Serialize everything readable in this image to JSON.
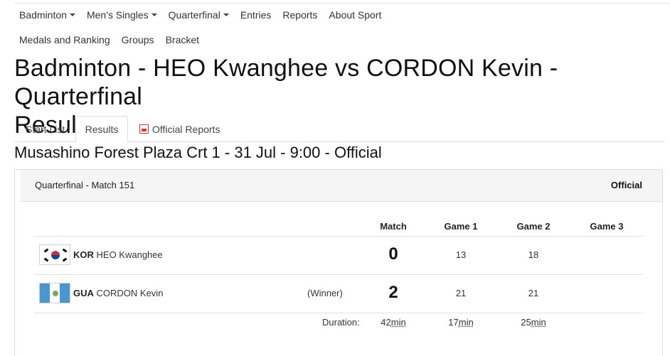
{
  "nav": {
    "row1": [
      {
        "label": "Badminton",
        "dropdown": true
      },
      {
        "label": "Men's Singles",
        "dropdown": true
      },
      {
        "label": "Quarterfinal",
        "dropdown": true
      },
      {
        "label": "Entries",
        "dropdown": false
      },
      {
        "label": "Reports",
        "dropdown": false
      },
      {
        "label": "About Sport",
        "dropdown": false
      }
    ],
    "row2": [
      {
        "label": "Medals and Ranking"
      },
      {
        "label": "Groups"
      },
      {
        "label": "Bracket"
      }
    ]
  },
  "page": {
    "title_line1": "Badminton - HEO Kwanghee vs CORDON Kevin - Quarterfinal",
    "title_line2": "Results"
  },
  "tabs": {
    "start_list": "Start List",
    "results": "Results",
    "official_reports": "Official Reports",
    "active": "Results"
  },
  "venue": "Musashino Forest Plaza Crt 1 - 31 Jul - 9:00 - Official",
  "match": {
    "header_left": "Quarterfinal  - Match 151",
    "header_right": "Official",
    "columns": {
      "match": "Match",
      "game1": "Game 1",
      "game2": "Game 2",
      "game3": "Game 3"
    },
    "players": [
      {
        "noc": "KOR",
        "name": "HEO Kwanghee",
        "status": "",
        "match": "0",
        "game1": "13",
        "game2": "18",
        "game3": ""
      },
      {
        "noc": "GUA",
        "name": "CORDON Kevin",
        "status": "(Winner)",
        "match": "2",
        "game1": "21",
        "game2": "21",
        "game3": ""
      }
    ],
    "duration": {
      "label": "Duration:",
      "match": "42",
      "game1": "17",
      "game2": "25",
      "unit": "min"
    }
  },
  "colors": {
    "kor_red": "#cd2e3a",
    "kor_blue": "#0047a0",
    "gua_blue": "#4997d0",
    "pdf_red": "#d33333"
  }
}
